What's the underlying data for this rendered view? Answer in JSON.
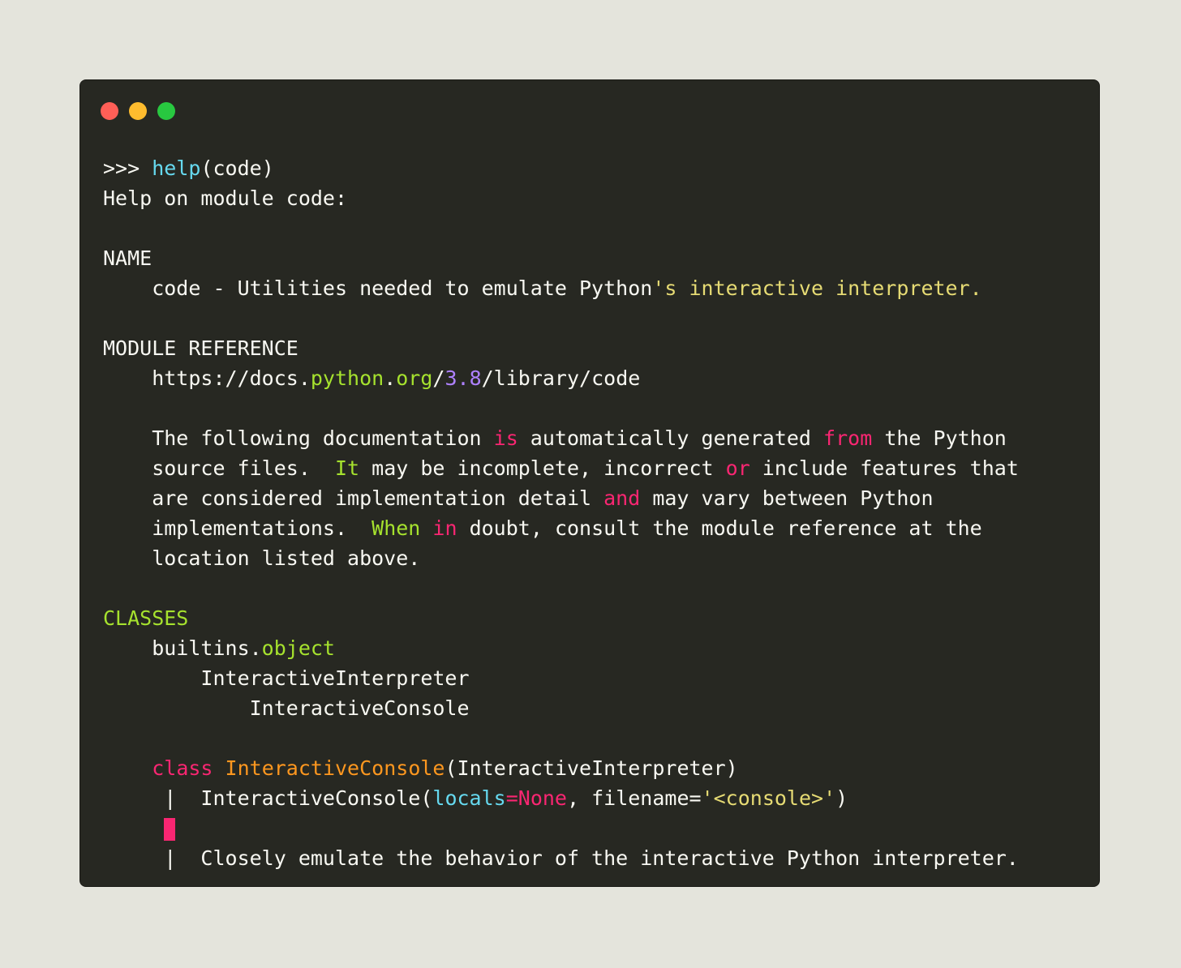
{
  "window_controls": [
    {
      "name": "close",
      "color": "#ff5f57"
    },
    {
      "name": "minimize",
      "color": "#febc2e"
    },
    {
      "name": "zoom",
      "color": "#28c840"
    }
  ],
  "colors": {
    "background": "#e4e4dc",
    "editor_bg": "#272822",
    "text": "#f8f8f2",
    "cyan": "#66d9ef",
    "green": "#a6e22e",
    "pink": "#f92672",
    "orange": "#fd971f",
    "yellow": "#e6db74",
    "purple": "#ae81ff"
  },
  "lines": [
    [
      {
        "t": ">>> ",
        "c": "text"
      },
      {
        "t": "help",
        "c": "cyan"
      },
      {
        "t": "(code)",
        "c": "text"
      }
    ],
    [
      {
        "t": "Help on module code:",
        "c": "text"
      }
    ],
    [],
    [
      {
        "t": "NAME",
        "c": "text"
      }
    ],
    [
      {
        "t": "    code - Utilities needed to emulate Python",
        "c": "text"
      },
      {
        "t": "'s interactive interpreter.",
        "c": "yellow"
      }
    ],
    [],
    [
      {
        "t": "MODULE REFERENCE",
        "c": "text"
      }
    ],
    [
      {
        "t": "    https://docs.",
        "c": "text"
      },
      {
        "t": "python",
        "c": "green"
      },
      {
        "t": ".",
        "c": "text"
      },
      {
        "t": "org",
        "c": "green"
      },
      {
        "t": "/",
        "c": "text"
      },
      {
        "t": "3.8",
        "c": "purple"
      },
      {
        "t": "/library/code",
        "c": "text"
      }
    ],
    [],
    [
      {
        "t": "    The following documentation ",
        "c": "text"
      },
      {
        "t": "is",
        "c": "pink"
      },
      {
        "t": " automatically generated ",
        "c": "text"
      },
      {
        "t": "from",
        "c": "pink"
      },
      {
        "t": " the Python",
        "c": "text"
      }
    ],
    [
      {
        "t": "    source files.  ",
        "c": "text"
      },
      {
        "t": "It",
        "c": "green"
      },
      {
        "t": " may be incomplete, incorrect ",
        "c": "text"
      },
      {
        "t": "or",
        "c": "pink"
      },
      {
        "t": " include features that",
        "c": "text"
      }
    ],
    [
      {
        "t": "    are considered implementation detail ",
        "c": "text"
      },
      {
        "t": "and",
        "c": "pink"
      },
      {
        "t": " may vary between Python",
        "c": "text"
      }
    ],
    [
      {
        "t": "    implementations.  ",
        "c": "text"
      },
      {
        "t": "When",
        "c": "green"
      },
      {
        "t": " ",
        "c": "text"
      },
      {
        "t": "in",
        "c": "pink"
      },
      {
        "t": " doubt, consult the module reference at the",
        "c": "text"
      }
    ],
    [
      {
        "t": "    location listed above.",
        "c": "text"
      }
    ],
    [],
    [
      {
        "t": "CLASSES",
        "c": "green"
      }
    ],
    [
      {
        "t": "    builtins.",
        "c": "text"
      },
      {
        "t": "object",
        "c": "green"
      }
    ],
    [
      {
        "t": "        InteractiveInterpreter",
        "c": "text"
      }
    ],
    [
      {
        "t": "            InteractiveConsole",
        "c": "text"
      }
    ],
    [],
    [
      {
        "t": "    ",
        "c": "text"
      },
      {
        "t": "class",
        "c": "pink"
      },
      {
        "t": " ",
        "c": "text"
      },
      {
        "t": "InteractiveConsole",
        "c": "orange"
      },
      {
        "t": "(InteractiveInterpreter)",
        "c": "text"
      }
    ],
    [
      {
        "t": "     |  InteractiveConsole(",
        "c": "text"
      },
      {
        "t": "locals",
        "c": "cyan"
      },
      {
        "t": "=",
        "c": "pink"
      },
      {
        "t": "None",
        "c": "pink"
      },
      {
        "t": ", filename=",
        "c": "text"
      },
      {
        "t": "'<console>'",
        "c": "yellow"
      },
      {
        "t": ")",
        "c": "text"
      }
    ],
    [
      {
        "t": "     ",
        "c": "text"
      },
      {
        "cursor": true
      }
    ],
    [
      {
        "t": "     |  Closely emulate the behavior of the interactive Python interpreter.",
        "c": "text"
      }
    ]
  ]
}
